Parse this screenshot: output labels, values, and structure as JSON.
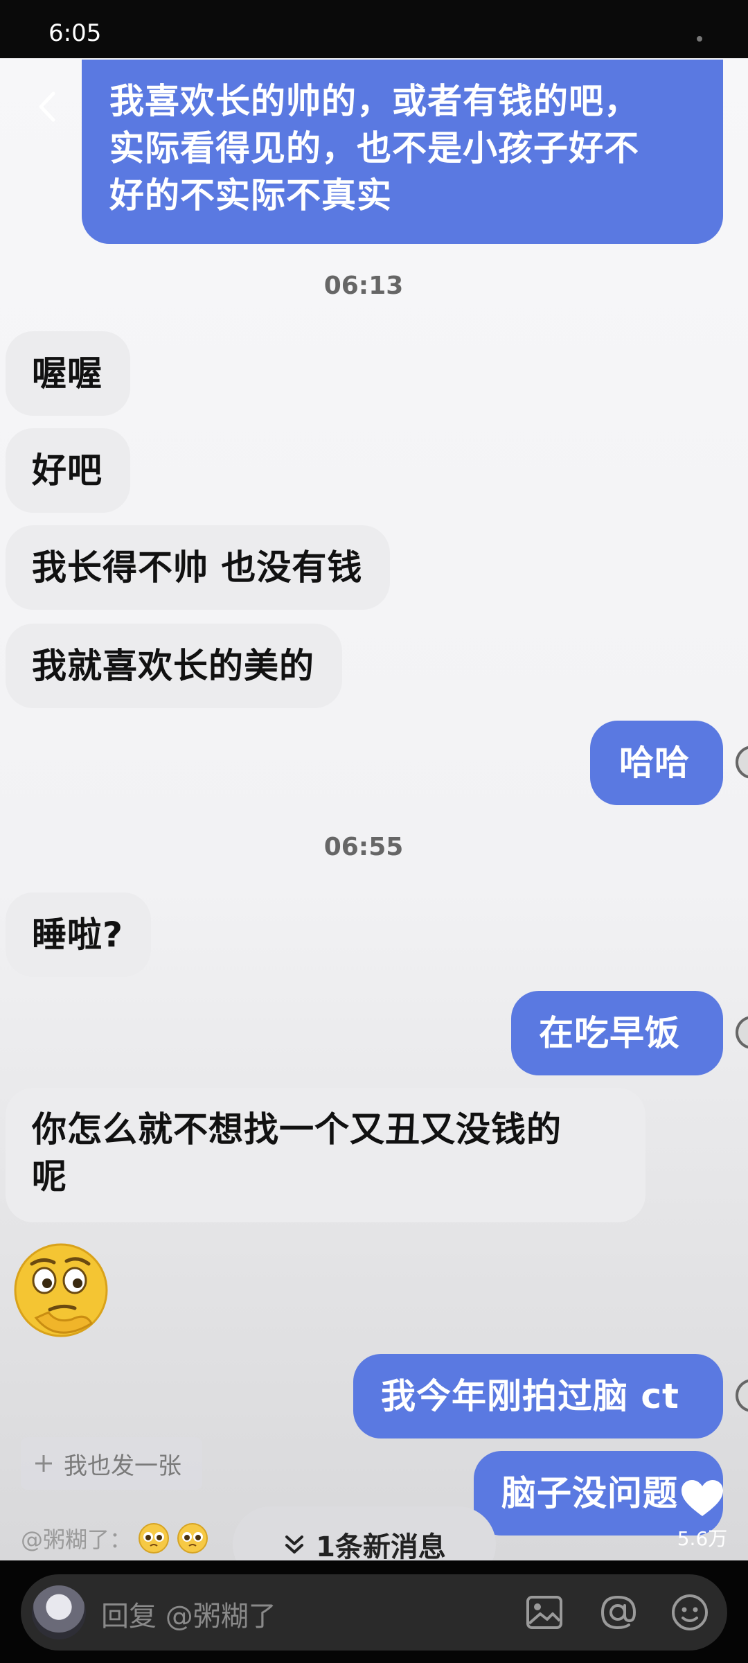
{
  "status": {
    "time": "6:05"
  },
  "chat": {
    "messages": [
      {
        "side": "out",
        "text_lines": [
          "我喜欢长的帅的，或者有钱的吧，",
          "实际看得见的，也不是小孩子好不",
          "好的不实际不真实"
        ]
      },
      {
        "timestamp": "06:13"
      },
      {
        "side": "in",
        "text": "喔喔"
      },
      {
        "side": "in",
        "text": "好吧"
      },
      {
        "side": "in",
        "text": "我长得不帅 也没有钱"
      },
      {
        "side": "in",
        "text": "我就喜欢长的美的"
      },
      {
        "side": "out",
        "text": "哈哈"
      },
      {
        "timestamp": "06:55"
      },
      {
        "side": "in",
        "text": "睡啦?"
      },
      {
        "side": "out",
        "text": "在吃早饭"
      },
      {
        "side": "in",
        "text_lines": [
          "你怎么就不想找一个又丑又没钱的",
          "呢"
        ]
      },
      {
        "side": "in",
        "emoji": "thinking-face"
      },
      {
        "side": "out",
        "text": "我今年刚拍过脑 ct"
      },
      {
        "side": "out",
        "text": "脑子没问题"
      }
    ]
  },
  "overlay": {
    "repost_label": "我也发一张",
    "comment_prefix": "@粥糊了：",
    "comment_emojis": [
      "pleading-face",
      "pleading-face"
    ],
    "new_message_label": "1条新消息",
    "likes": "5.6万"
  },
  "reply_bar": {
    "placeholder": "回复 @粥糊了"
  },
  "colors": {
    "outgoing_bubble": "#5a79e1",
    "incoming_bubble": "#ececee",
    "background": "#f4f4f6"
  }
}
